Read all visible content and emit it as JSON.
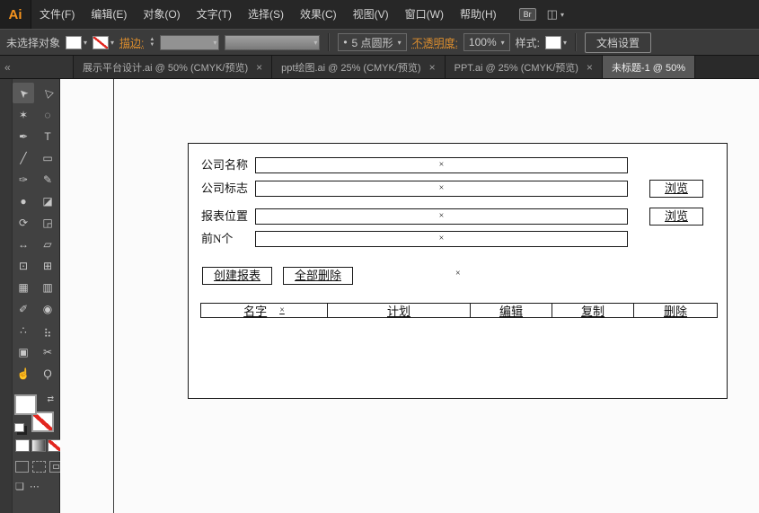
{
  "colors": {
    "accent_orange": "#db8d2e",
    "ui_dark": "#272727",
    "none_red": "#e2261f",
    "canvas_bg": "#fbfbfb"
  },
  "menubar": {
    "logo": "Ai",
    "items": [
      "文件(F)",
      "编辑(E)",
      "对象(O)",
      "文字(T)",
      "选择(S)",
      "效果(C)",
      "视图(V)",
      "窗口(W)",
      "帮助(H)"
    ],
    "bridge": "Br"
  },
  "controlbar": {
    "selection_status": "未选择对象",
    "stroke_label": "描边:",
    "brush_bullet": "•",
    "brush_value": "5 点圆形",
    "opacity_label": "不透明度:",
    "opacity_value": "100%",
    "style_label": "样式:",
    "document_setup": "文档设置"
  },
  "tabbar": {
    "collapse_icon": "«",
    "tabs": [
      {
        "title": "展示平台设计.ai @ 50% (CMYK/预览)",
        "close": "×",
        "active": false
      },
      {
        "title": "ppt绘图.ai @ 25% (CMYK/预览)",
        "close": "×",
        "active": false
      },
      {
        "title": "PPT.ai @ 25% (CMYK/预览)",
        "close": "×",
        "active": false
      },
      {
        "title": "未标题-1 @ 50%",
        "close": "",
        "active": true
      }
    ]
  },
  "icons": {
    "dropdown": "▾",
    "workspace": "◫",
    "swap": "⇄",
    "stepper_up": "▲",
    "stepper_down": "▼"
  },
  "tools": [
    {
      "name": "selection-tool",
      "glyph": "➤"
    },
    {
      "name": "direct-selection-tool",
      "glyph": "▷"
    },
    {
      "name": "magic-wand-tool",
      "glyph": "✶"
    },
    {
      "name": "lasso-tool",
      "glyph": "◌"
    },
    {
      "name": "pen-tool",
      "glyph": "✒"
    },
    {
      "name": "type-tool",
      "glyph": "T"
    },
    {
      "name": "line-segment-tool",
      "glyph": "╱"
    },
    {
      "name": "rectangle-tool",
      "glyph": "▭"
    },
    {
      "name": "paintbrush-tool",
      "glyph": "✑"
    },
    {
      "name": "pencil-tool",
      "glyph": "✎"
    },
    {
      "name": "blob-brush-tool",
      "glyph": "●"
    },
    {
      "name": "eraser-tool",
      "glyph": "◪"
    },
    {
      "name": "rotate-tool",
      "glyph": "⟳"
    },
    {
      "name": "scale-tool",
      "glyph": "◲"
    },
    {
      "name": "width-tool",
      "glyph": "↔"
    },
    {
      "name": "free-transform-tool",
      "glyph": "▱"
    },
    {
      "name": "shape-builder-tool",
      "glyph": "⊡"
    },
    {
      "name": "perspective-grid-tool",
      "glyph": "⊞"
    },
    {
      "name": "mesh-tool",
      "glyph": "▦"
    },
    {
      "name": "gradient-tool",
      "glyph": "▥"
    },
    {
      "name": "eyedropper-tool",
      "glyph": "✐"
    },
    {
      "name": "blend-tool",
      "glyph": "◉"
    },
    {
      "name": "symbol-sprayer-tool",
      "glyph": "∴"
    },
    {
      "name": "column-graph-tool",
      "glyph": "⣦"
    },
    {
      "name": "artboard-tool",
      "glyph": "▣"
    },
    {
      "name": "slice-tool",
      "glyph": "✂"
    },
    {
      "name": "hand-tool",
      "glyph": "☝"
    },
    {
      "name": "zoom-tool",
      "glyph": "Ϙ"
    }
  ],
  "artboard": {
    "fields": [
      {
        "label": "公司名称",
        "mark": "×"
      },
      {
        "label": "公司标志",
        "mark": "×",
        "browse": "浏览"
      },
      {
        "label": "报表位置",
        "mark": "×",
        "browse": "浏览"
      },
      {
        "label": "前N个",
        "mark": "×"
      }
    ],
    "buttons": [
      "创建报表",
      "全部删除"
    ],
    "stray_mark": "×",
    "table": {
      "headers": [
        "名字",
        "计划",
        "编辑",
        "复制",
        "删除"
      ],
      "name_mark": "×"
    }
  }
}
